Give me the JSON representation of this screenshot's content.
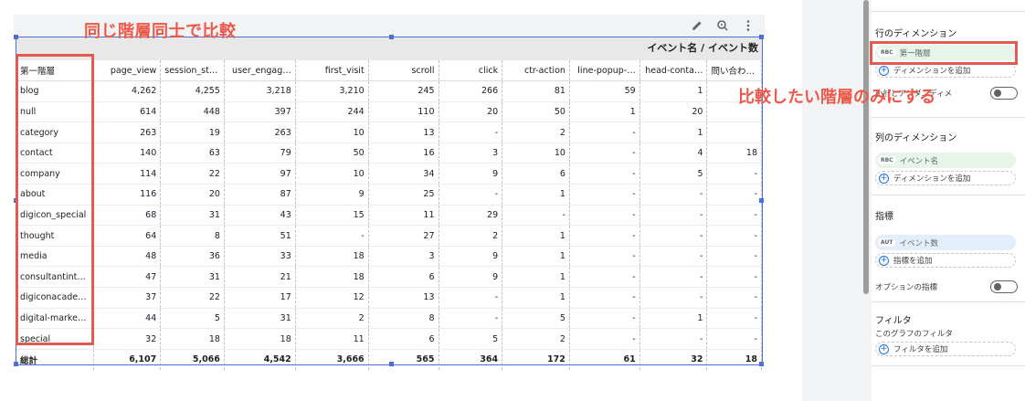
{
  "table": {
    "header_title": "イベント名 / イベント数",
    "columns": [
      "第一階層",
      "page_view",
      "session_start",
      "user_engag…",
      "first_visit",
      "scroll",
      "click",
      "ctr-action",
      "line-popup-…",
      "head-conta…",
      "問い合わせ…"
    ],
    "rows": [
      [
        "blog",
        "4,262",
        "4,255",
        "3,218",
        "3,210",
        "245",
        "266",
        "81",
        "59",
        "1",
        ""
      ],
      [
        "null",
        "614",
        "448",
        "397",
        "244",
        "110",
        "20",
        "50",
        "1",
        "20",
        ""
      ],
      [
        "category",
        "263",
        "19",
        "263",
        "10",
        "13",
        "-",
        "2",
        "-",
        "1",
        ""
      ],
      [
        "contact",
        "140",
        "63",
        "79",
        "50",
        "16",
        "3",
        "10",
        "-",
        "4",
        "18"
      ],
      [
        "company",
        "114",
        "22",
        "97",
        "10",
        "34",
        "9",
        "6",
        "-",
        "5",
        "-"
      ],
      [
        "about",
        "116",
        "20",
        "87",
        "9",
        "25",
        "-",
        "1",
        "-",
        "-",
        "-"
      ],
      [
        "digicon_special",
        "68",
        "31",
        "43",
        "15",
        "11",
        "29",
        "-",
        "-",
        "-",
        "-"
      ],
      [
        "thought",
        "64",
        "8",
        "51",
        "-",
        "27",
        "2",
        "1",
        "-",
        "-",
        "-"
      ],
      [
        "media",
        "48",
        "36",
        "33",
        "18",
        "3",
        "9",
        "1",
        "-",
        "-",
        "-"
      ],
      [
        "consultantintr…",
        "47",
        "31",
        "21",
        "18",
        "6",
        "9",
        "1",
        "-",
        "-",
        "-"
      ],
      [
        "digiconacademy",
        "37",
        "22",
        "17",
        "12",
        "13",
        "-",
        "1",
        "-",
        "-",
        "-"
      ],
      [
        "digital-marketi…",
        "44",
        "5",
        "31",
        "2",
        "8",
        "-",
        "5",
        "-",
        "1",
        "-"
      ],
      [
        "special",
        "32",
        "18",
        "18",
        "11",
        "6",
        "5",
        "2",
        "-",
        "-",
        "-"
      ]
    ],
    "total": [
      "総計",
      "6,107",
      "5,066",
      "4,542",
      "3,666",
      "565",
      "364",
      "172",
      "61",
      "32",
      "18"
    ]
  },
  "annotations": {
    "left_text": "同じ階層同士で比較",
    "right_text": "比較したい階層のみにする"
  },
  "panel": {
    "row_dim_title": "行のディメンション",
    "row_dim_chip_badge": "RBC",
    "row_dim_chip": "第一階層",
    "row_dim_add": "ディメンションを追加",
    "row_dim_toggle_label": "小計とアンダ…ディメ",
    "col_dim_title": "列のディメンション",
    "col_dim_chip_badge": "RBC",
    "col_dim_chip": "イベント名",
    "col_dim_add": "ディメンションを追加",
    "metric_title": "指標",
    "metric_chip_badge": "AUT",
    "metric_chip": "イベント数",
    "metric_add": "指標を追加",
    "optional_metric_label": "オプションの指標",
    "filter_title": "フィルタ",
    "filter_sub": "このグラフのフィルタ",
    "filter_add": "フィルタを追加"
  },
  "colors": {
    "accent": "#ef5748",
    "selection": "#4a6fd8",
    "chip_green": "#e6f4ea",
    "chip_blue": "#e3eefc"
  },
  "icons": [
    "pencil-icon",
    "zoom-icon",
    "more-vert-icon",
    "plus-circle-icon"
  ]
}
